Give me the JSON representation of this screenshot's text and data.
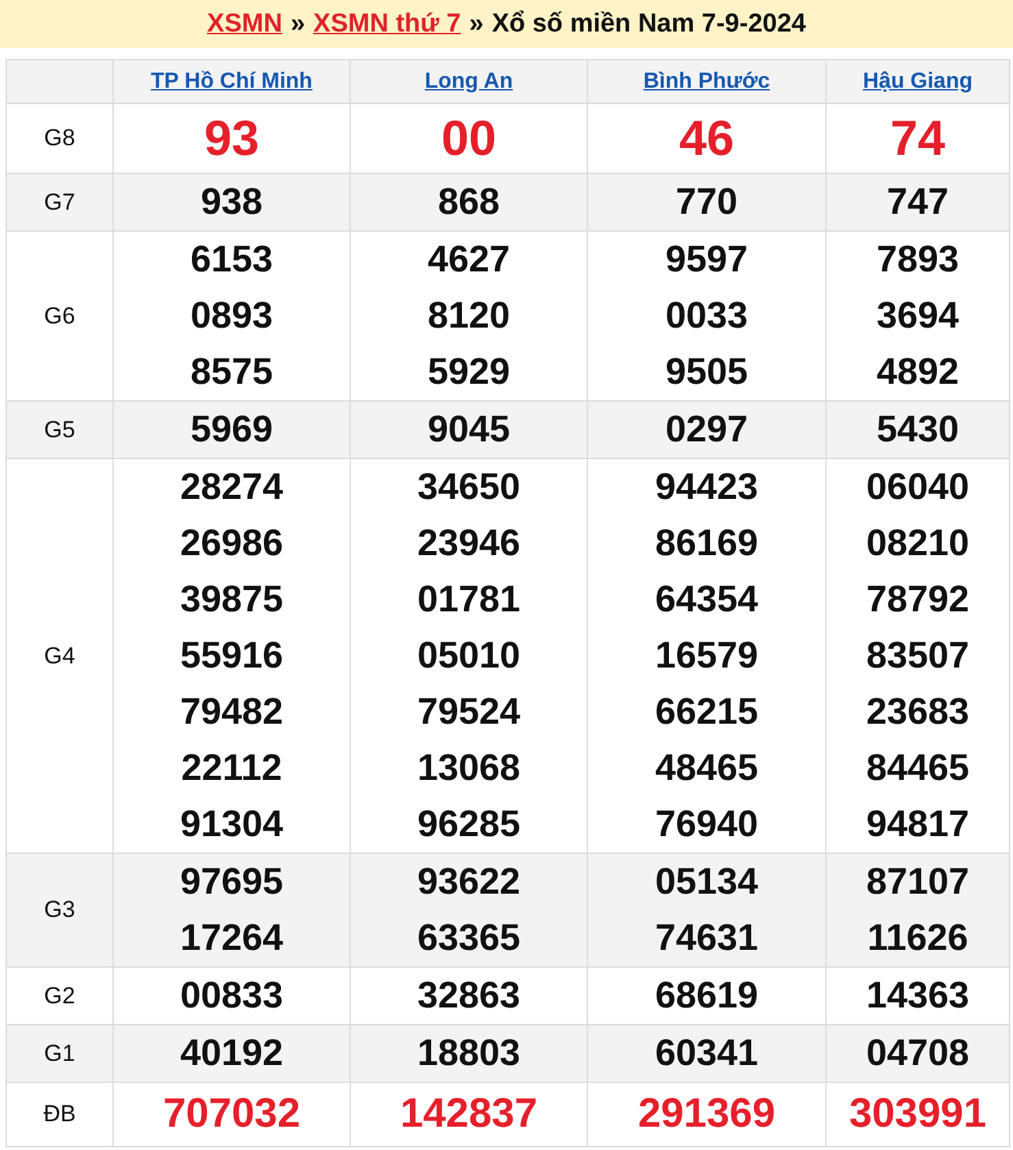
{
  "breadcrumb": [
    {
      "kind": "link",
      "text": "XSMN"
    },
    {
      "kind": "separator",
      "text": "»"
    },
    {
      "kind": "link",
      "text": "XSMN thứ 7"
    },
    {
      "kind": "separator",
      "text": "»"
    },
    {
      "kind": "title",
      "text": "Xổ số miền Nam 7-9-2024"
    }
  ],
  "table": {
    "columns": [
      "TP Hồ Chí Minh",
      "Long An",
      "Bình Phước",
      "Hậu Giang"
    ],
    "rows": [
      {
        "label": "G8",
        "kind": "big",
        "cells": [
          [
            "93"
          ],
          [
            "00"
          ],
          [
            "46"
          ],
          [
            "74"
          ]
        ]
      },
      {
        "label": "G7",
        "kind": "number",
        "cells": [
          [
            "938"
          ],
          [
            "868"
          ],
          [
            "770"
          ],
          [
            "747"
          ]
        ]
      },
      {
        "label": "G6",
        "kind": "number",
        "cells": [
          [
            "6153",
            "0893",
            "8575"
          ],
          [
            "4627",
            "8120",
            "5929"
          ],
          [
            "9597",
            "0033",
            "9505"
          ],
          [
            "7893",
            "3694",
            "4892"
          ]
        ]
      },
      {
        "label": "G5",
        "kind": "number",
        "cells": [
          [
            "5969"
          ],
          [
            "9045"
          ],
          [
            "0297"
          ],
          [
            "5430"
          ]
        ]
      },
      {
        "label": "G4",
        "kind": "number",
        "cells": [
          [
            "28274",
            "26986",
            "39875",
            "55916",
            "79482",
            "22112",
            "91304"
          ],
          [
            "34650",
            "23946",
            "01781",
            "05010",
            "79524",
            "13068",
            "96285"
          ],
          [
            "94423",
            "86169",
            "64354",
            "16579",
            "66215",
            "48465",
            "76940"
          ],
          [
            "06040",
            "08210",
            "78792",
            "83507",
            "23683",
            "84465",
            "94817"
          ]
        ]
      },
      {
        "label": "G3",
        "kind": "number",
        "cells": [
          [
            "97695",
            "17264"
          ],
          [
            "93622",
            "63365"
          ],
          [
            "05134",
            "74631"
          ],
          [
            "87107",
            "11626"
          ]
        ]
      },
      {
        "label": "G2",
        "kind": "number",
        "cells": [
          [
            "00833"
          ],
          [
            "32863"
          ],
          [
            "68619"
          ],
          [
            "14363"
          ]
        ]
      },
      {
        "label": "G1",
        "kind": "number",
        "cells": [
          [
            "40192"
          ],
          [
            "18803"
          ],
          [
            "60341"
          ],
          [
            "04708"
          ]
        ]
      },
      {
        "label": "ĐB",
        "kind": "special",
        "cells": [
          [
            "707032"
          ],
          [
            "142837"
          ],
          [
            "291369"
          ],
          [
            "303991"
          ]
        ]
      }
    ]
  }
}
